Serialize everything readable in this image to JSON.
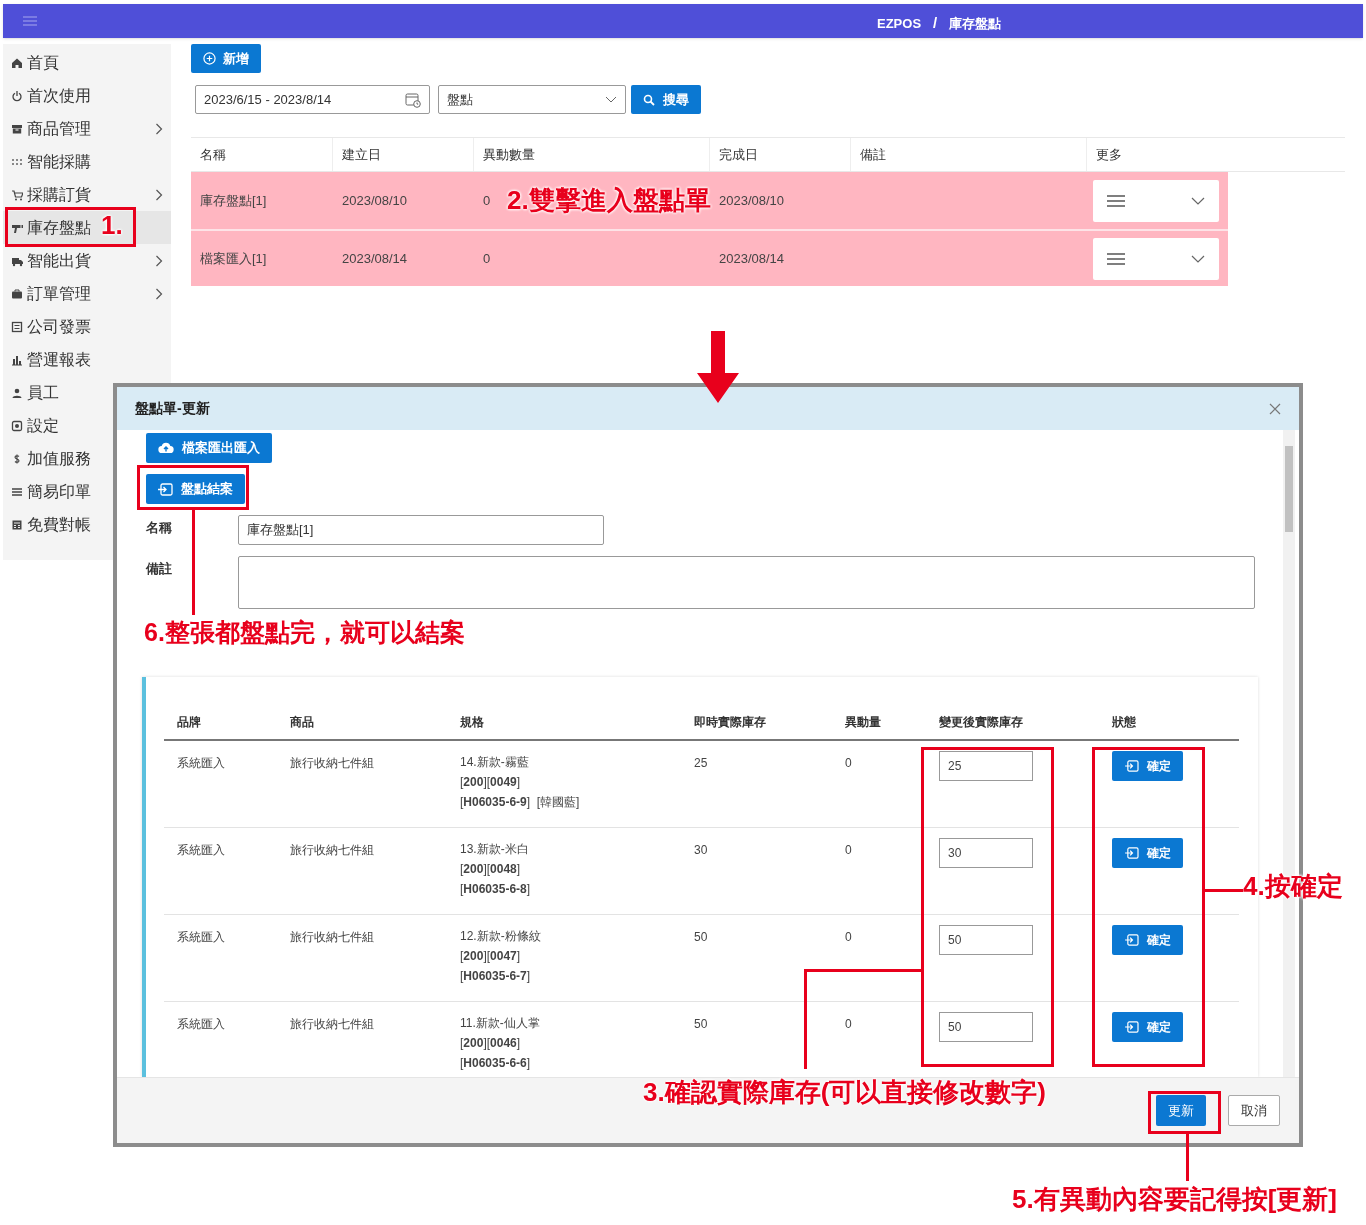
{
  "header": {
    "brand": "EZPOS",
    "separator": "/",
    "page": "庫存盤點"
  },
  "sidebar": {
    "items": [
      {
        "label": "首頁",
        "has_submenu": false,
        "selected": false
      },
      {
        "label": "首次使用",
        "has_submenu": false,
        "selected": false
      },
      {
        "label": "商品管理",
        "has_submenu": true,
        "selected": false
      },
      {
        "label": "智能採購",
        "has_submenu": false,
        "selected": false
      },
      {
        "label": "採購訂貨",
        "has_submenu": true,
        "selected": false
      },
      {
        "label": "庫存盤點",
        "has_submenu": false,
        "selected": true
      },
      {
        "label": "智能出貨",
        "has_submenu": true,
        "selected": false
      },
      {
        "label": "訂單管理",
        "has_submenu": true,
        "selected": false
      },
      {
        "label": "公司發票",
        "has_submenu": false,
        "selected": false
      },
      {
        "label": "營運報表",
        "has_submenu": false,
        "selected": false
      },
      {
        "label": "員工",
        "has_submenu": false,
        "selected": false
      },
      {
        "label": "設定",
        "has_submenu": false,
        "selected": false
      },
      {
        "label": "加值服務",
        "has_submenu": false,
        "selected": false
      },
      {
        "label": "簡易印單",
        "has_submenu": false,
        "selected": false
      },
      {
        "label": "免費對帳",
        "has_submenu": false,
        "selected": false
      }
    ]
  },
  "toolbar": {
    "add_button": "新增",
    "date_range": "2023/6/15 - 2023/8/14",
    "type_select": "盤點",
    "search_button": "搜尋"
  },
  "table": {
    "columns": [
      "名稱",
      "建立日",
      "異動數量",
      "完成日",
      "備註",
      "更多"
    ],
    "rows": [
      {
        "cells": [
          "庫存盤點[1]",
          "2023/08/10",
          "0",
          "2023/08/10",
          ""
        ],
        "highlighted": true
      },
      {
        "cells": [
          "檔案匯入[1]",
          "2023/08/14",
          "0",
          "2023/08/14",
          ""
        ],
        "highlighted": true
      }
    ]
  },
  "dialog": {
    "title": "盤點單-更新",
    "export_button": "檔案匯出匯入",
    "close_out_button": "盤點結案",
    "name_label": "名稱",
    "name_value": "庫存盤點[1]",
    "note_label": "備註",
    "items": {
      "columns": [
        "品牌",
        "商品",
        "規格",
        "即時實際庫存",
        "異動量",
        "變更後實際庫存",
        "狀態"
      ],
      "rows": [
        {
          "brand": "系統匯入",
          "product": "旅行收納七件組",
          "spec": [
            "14.新款-霧藍",
            "[**200**][**0049**]",
            "[**H06035-6-9**]  [韓國藍]"
          ],
          "stock": "25",
          "change": "0",
          "new_stock": "25",
          "confirm": "確定"
        },
        {
          "brand": "系統匯入",
          "product": "旅行收納七件組",
          "spec": [
            "13.新款-米白",
            "[**200**][**0048**]",
            "[**H06035-6-8**]"
          ],
          "stock": "30",
          "change": "0",
          "new_stock": "30",
          "confirm": "確定"
        },
        {
          "brand": "系統匯入",
          "product": "旅行收納七件組",
          "spec": [
            "12.新款-粉條紋",
            "[**200**][**0047**]",
            "[**H06035-6-7**]"
          ],
          "stock": "50",
          "change": "0",
          "new_stock": "50",
          "confirm": "確定"
        },
        {
          "brand": "系統匯入",
          "product": "旅行收納七件組",
          "spec": [
            "11.新款-仙人掌",
            "[**200**][**0046**]",
            "[**H06035-6-6**]"
          ],
          "stock": "50",
          "change": "0",
          "new_stock": "50",
          "confirm": "確定"
        }
      ]
    },
    "update_button": "更新",
    "cancel_button": "取消"
  },
  "annotations": [
    "1.",
    "2.雙擊進入盤點單",
    "6.整張都盤點完，就可以結案",
    "3.確認實際庫存(可以直接修改數字)",
    "4.按確定",
    "5.有異動內容要記得按[更新]"
  ]
}
